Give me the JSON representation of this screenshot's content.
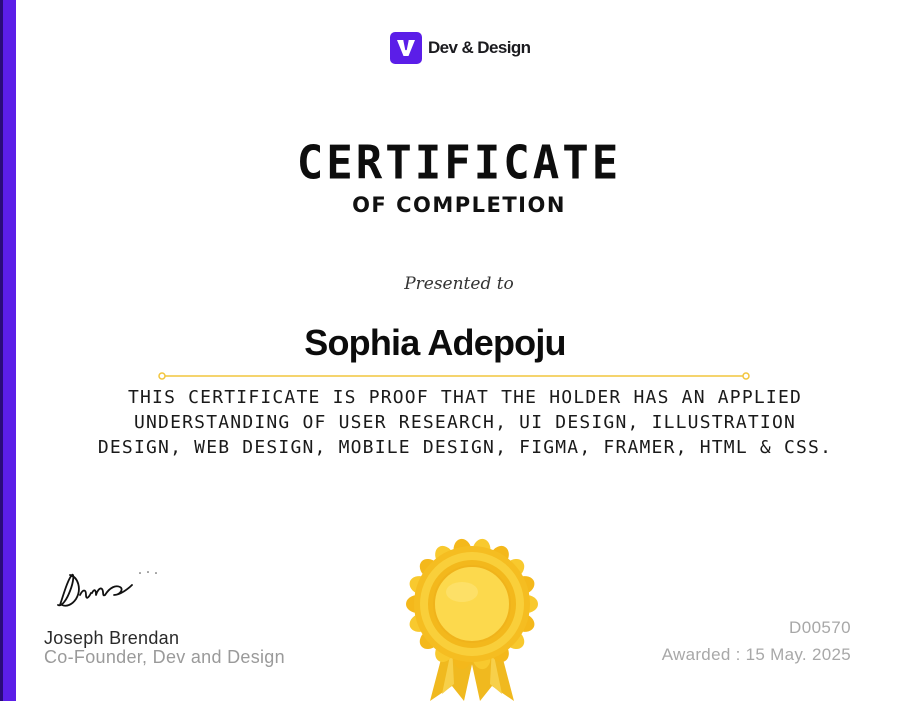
{
  "brand": {
    "name": "Dev & Design",
    "logo_icon": "v-logo-icon",
    "accent_color": "#5b1ee8"
  },
  "certificate": {
    "title": "CERTIFICATE",
    "subtitle": "OF COMPLETION",
    "presented_label": "Presented to",
    "recipient": "Sophia Adepoju",
    "statement": "THIS CERTIFICATE IS PROOF THAT THE HOLDER HAS AN APPLIED UNDERSTANDING OF USER RESEARCH, UI DESIGN, ILLUSTRATION DESIGN, WEB DESIGN, MOBILE DESIGN, FIGMA, FRAMER, HTML & CSS."
  },
  "signatory": {
    "name": "Joseph Brendan",
    "role": "Co-Founder, Dev and Design"
  },
  "meta": {
    "id": "D00570",
    "awarded": "Awarded : 15 May. 2025"
  },
  "seal": {
    "icon": "award-rosette-icon",
    "gold_color": "#f6c22b",
    "divider_color": "#f2c53d"
  }
}
